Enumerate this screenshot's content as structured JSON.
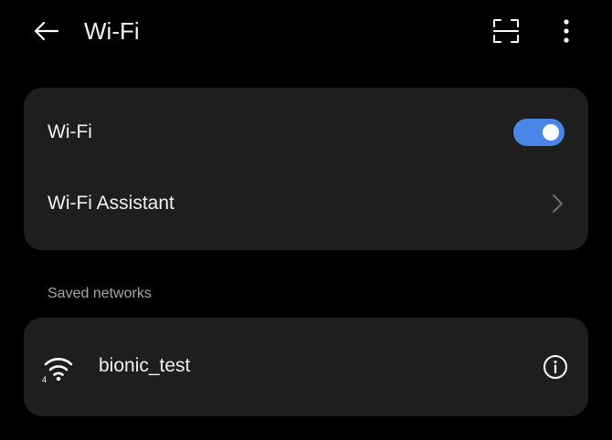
{
  "header": {
    "title": "Wi-Fi",
    "back_icon": "arrow-left-icon",
    "scan_icon": "scan-qr-icon",
    "more_icon": "more-vertical-icon"
  },
  "main_card": {
    "wifi_label": "Wi-Fi",
    "wifi_enabled": true,
    "assistant_label": "Wi-Fi Assistant",
    "assistant_icon": "chevron-right-icon"
  },
  "saved": {
    "section_title": "Saved networks",
    "networks": [
      {
        "name": "bionic_test",
        "signal_icon": "wifi-4-icon",
        "info_icon": "info-icon"
      }
    ]
  },
  "colors": {
    "background": "#000000",
    "card": "#1e1e1e",
    "toggle_on": "#4a86e8",
    "secondary_text": "#a6a6a6"
  }
}
